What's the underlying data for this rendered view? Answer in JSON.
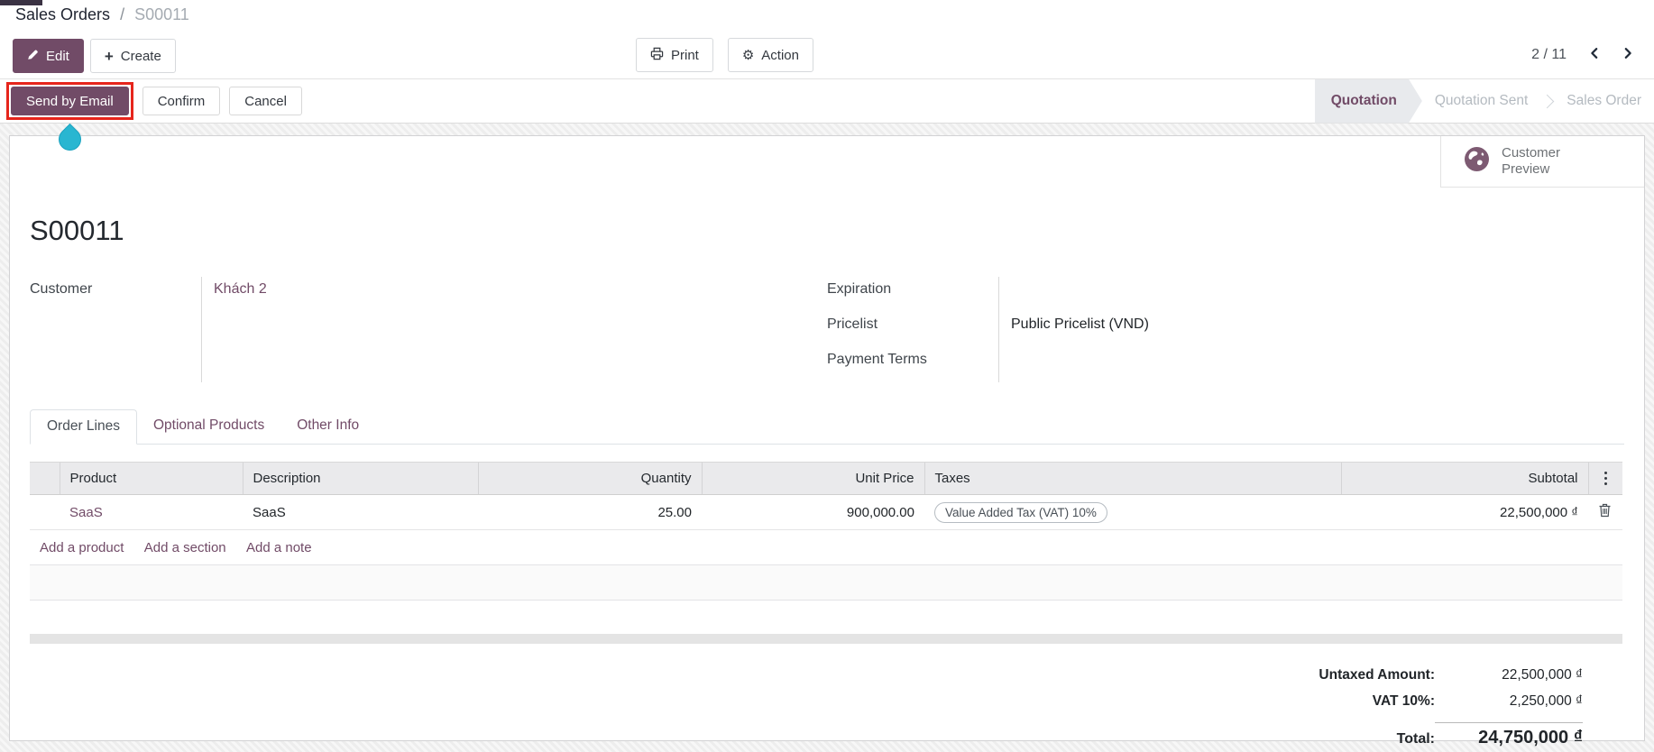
{
  "breadcrumb": {
    "parent": "Sales Orders",
    "separator": "/",
    "current": "S00011"
  },
  "control_panel": {
    "edit_label": "Edit",
    "create_label": "Create",
    "print_label": "Print",
    "action_label": "Action",
    "pager": "2 / 11"
  },
  "statusbar": {
    "buttons": [
      {
        "label": "Send by Email",
        "primary": true,
        "highlighted": true
      },
      {
        "label": "Confirm"
      },
      {
        "label": "Cancel"
      }
    ],
    "stages": [
      {
        "label": "Quotation",
        "active": true
      },
      {
        "label": "Quotation Sent",
        "active": false
      },
      {
        "label": "Sales Order",
        "active": false
      }
    ]
  },
  "sheet": {
    "preview_button": {
      "line1": "Customer",
      "line2": "Preview"
    },
    "title": "S00011",
    "left_group": {
      "customer_label": "Customer",
      "customer_value": "Khách 2"
    },
    "right_group": {
      "expiration_label": "Expiration",
      "expiration_value": "",
      "pricelist_label": "Pricelist",
      "pricelist_value": "Public Pricelist (VND)",
      "payment_terms_label": "Payment Terms",
      "payment_terms_value": ""
    },
    "tabs": [
      {
        "label": "Order Lines",
        "active": true
      },
      {
        "label": "Optional Products",
        "active": false
      },
      {
        "label": "Other Info",
        "active": false
      }
    ],
    "order_lines": {
      "columns": [
        "Product",
        "Description",
        "Quantity",
        "Unit Price",
        "Taxes",
        "Subtotal"
      ],
      "rows": [
        {
          "product": "SaaS",
          "description": "SaaS",
          "quantity": "25.00",
          "unit_price": "900,000.00",
          "taxes": "Value Added Tax (VAT) 10%",
          "subtotal": "22,500,000 ₫"
        }
      ],
      "footer_links": [
        "Add a product",
        "Add a section",
        "Add a note"
      ]
    },
    "totals": {
      "untaxed_label": "Untaxed Amount:",
      "untaxed_value": "22,500,000 ₫",
      "vat_label": "VAT 10%:",
      "vat_value": "2,250,000 ₫",
      "total_label": "Total:",
      "total_value": "24,750,000 ₫"
    }
  },
  "icons": [
    "pencil-icon",
    "plus-icon",
    "printer-icon",
    "gear-icon",
    "chevron-left-icon",
    "chevron-right-icon",
    "globe-icon",
    "trash-icon",
    "column-options-icon"
  ],
  "colors": {
    "primary": "#714B67",
    "annotation_red": "#e6251c",
    "cursor_teal": "#29b6d1"
  }
}
